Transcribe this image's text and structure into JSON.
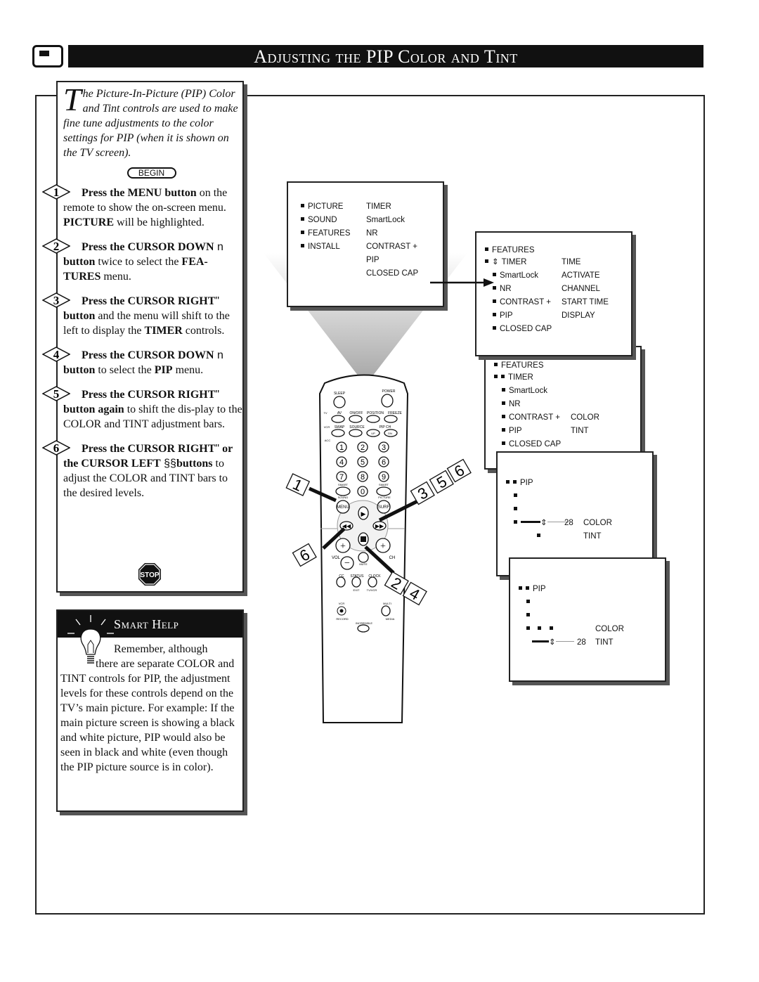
{
  "header": {
    "title": "Adjusting the PIP Color and Tint",
    "icon": "tv-icon"
  },
  "intro": {
    "drop_cap": "T",
    "text": "he Picture-In-Picture (PIP) Color and Tint controls are used to make fine tune adjustments to the color settings for PIP (when it is shown on the TV screen).",
    "begin": "BEGIN"
  },
  "steps": [
    {
      "n": "1",
      "bold": "Press the MENU button",
      "rest": " on the remote to show the on-screen menu. ",
      "bold2": "PICTURE",
      "rest2": " will be highlighted."
    },
    {
      "n": "2",
      "bold": "Press the CURSOR DOWN",
      "sym": " n",
      "bold2": "button",
      "rest2": " twice to select the ",
      "bold3": "FEA-TURES",
      "rest3": " menu."
    },
    {
      "n": "3",
      "bold": "Press the CURSOR RIGHT",
      "sym": "\"",
      "bold2": "button",
      "rest2": " and the menu will shift to the left to display the ",
      "bold3": "TIMER",
      "rest3": " controls."
    },
    {
      "n": "4",
      "bold": "Press the CURSOR DOWN",
      "sym": " n",
      "bold2": "button",
      "rest2": " to select the ",
      "bold3": "PIP",
      "rest3": " menu."
    },
    {
      "n": "5",
      "bold": "Press the CURSOR RIGHT",
      "sym": "\"",
      "bold2": "button again",
      "rest2": " to shift the dis-play to the COLOR and TINT adjustment bars."
    },
    {
      "n": "6",
      "bold": "Press the CURSOR RIGHT",
      "sym": "\"",
      "bold2": "or the CURSOR LEFT",
      "sym2": " §§",
      "bold3": "buttons",
      "rest3": "  to adjust the COLOR and TINT bars to the desired levels."
    }
  ],
  "stop": "STOP",
  "smart_help": {
    "title": "Smart Help",
    "text1": "Remember, although",
    "text2": "there are separate COLOR and TINT controls for PIP, the adjustment levels for these controls depend on the TV’s main picture. For example: If the main picture screen is showing a black and white picture, PIP would also be seen in black and white (even though the PIP picture source is in color)."
  },
  "menu1": {
    "left": [
      "PICTURE",
      "SOUND",
      "FEATURES",
      "INSTALL"
    ],
    "right": [
      "TIMER",
      "SmartLock",
      "NR",
      "CONTRAST +",
      "PIP",
      "CLOSED CAP"
    ]
  },
  "menu2": {
    "title": "FEATURES",
    "left": [
      "TIMER",
      "SmartLock",
      "NR",
      "CONTRAST +",
      "PIP",
      "CLOSED CAP"
    ],
    "right": [
      "TIME",
      "ACTIVATE",
      "CHANNEL",
      "START TIME",
      "DISPLAY"
    ]
  },
  "menu3": {
    "title": "FEATURES",
    "left": [
      "TIMER",
      "SmartLock",
      "NR",
      "CONTRAST +",
      "PIP",
      "CLOSED CAP"
    ],
    "right": [
      "COLOR",
      "TINT"
    ]
  },
  "menu4": {
    "title": "PIP",
    "value": "28",
    "right": [
      "COLOR",
      "TINT"
    ]
  },
  "menu5": {
    "title": "PIP",
    "value": "28",
    "right": [
      "COLOR",
      "TINT"
    ]
  },
  "remote": {
    "labels": {
      "sleep": "SLEEP",
      "power": "POWER",
      "tv": "TV",
      "vcr": "VCR",
      "acc": "ACC",
      "av": "AV",
      "onoff": "ON/OFF",
      "position": "POSITION",
      "freeze": "FREEZE",
      "swap": "SWAP",
      "source": "SOURCE",
      "pipch": "PIP CH",
      "up": "UP",
      "dn": "DN",
      "smart1": "SMART",
      "sound": "SOUND",
      "smart2": "SMART",
      "picture": "PICTURE",
      "menu": "MENU",
      "surf": "SURF",
      "vol": "VOL",
      "ch": "CH",
      "mute": "MUTE",
      "cc": "CC",
      "status": "STATUS",
      "exit": "EXIT",
      "clock": "CLOCK",
      "tvvcr": "TV/VCR",
      "vcr2": "VCR",
      "record": "RECORD",
      "multi": "MULTI",
      "media": "MEDIA",
      "incredible": "INCREDIBLE"
    },
    "digits": [
      "1",
      "2",
      "3",
      "4",
      "5",
      "6",
      "7",
      "8",
      "9",
      "0"
    ]
  },
  "callouts": {
    "a": "1",
    "b": "3",
    "c": "5",
    "d": "6",
    "e": "6",
    "f": "2",
    "g": "4"
  }
}
